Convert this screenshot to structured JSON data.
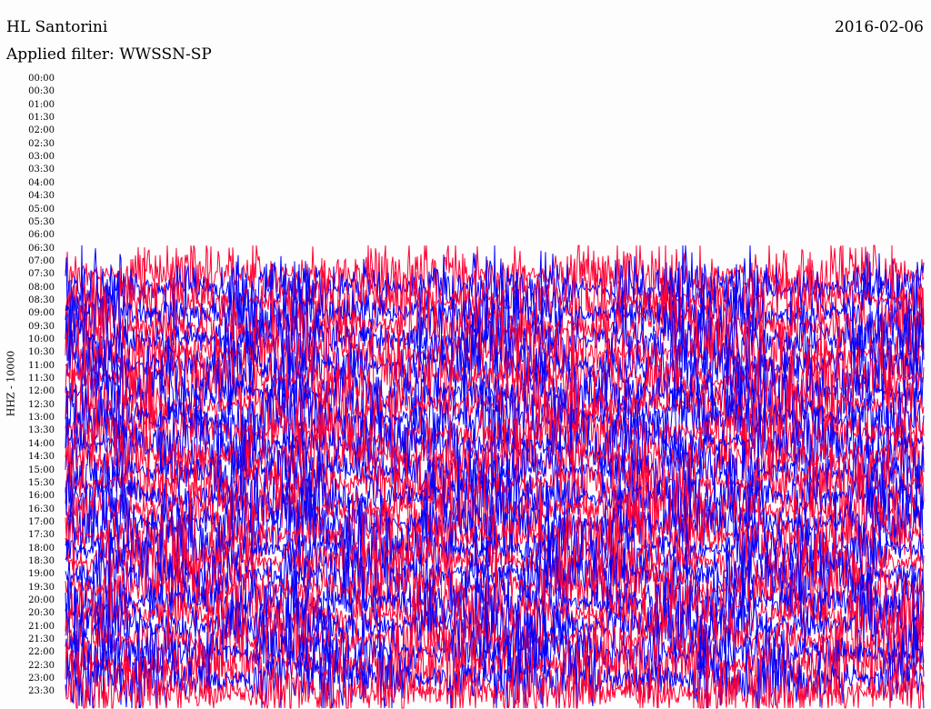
{
  "header": {
    "station": "HL Santorini",
    "date": "2016-02-06",
    "filter": "Applied filter: WWSSN-SP"
  },
  "chart_data": {
    "type": "line",
    "ylabel": "HHZ - 10000",
    "time_labels": [
      "00:00",
      "00:30",
      "01:00",
      "01:30",
      "02:00",
      "02:30",
      "03:00",
      "03:30",
      "04:00",
      "04:30",
      "05:00",
      "05:30",
      "06:00",
      "06:30",
      "07:00",
      "07:30",
      "08:00",
      "08:30",
      "09:00",
      "09:30",
      "10:00",
      "10:30",
      "11:00",
      "11:30",
      "12:00",
      "12:30",
      "13:00",
      "13:30",
      "14:00",
      "14:30",
      "15:00",
      "15:30",
      "16:00",
      "16:30",
      "17:00",
      "17:30",
      "18:00",
      "18:30",
      "19:00",
      "19:30",
      "20:00",
      "20:30",
      "21:00",
      "21:30",
      "22:00",
      "22:30",
      "23:00",
      "23:30"
    ],
    "first_trace": "07:30",
    "trace_colors": [
      "#ff0033",
      "#0000ff"
    ],
    "grid": false
  }
}
